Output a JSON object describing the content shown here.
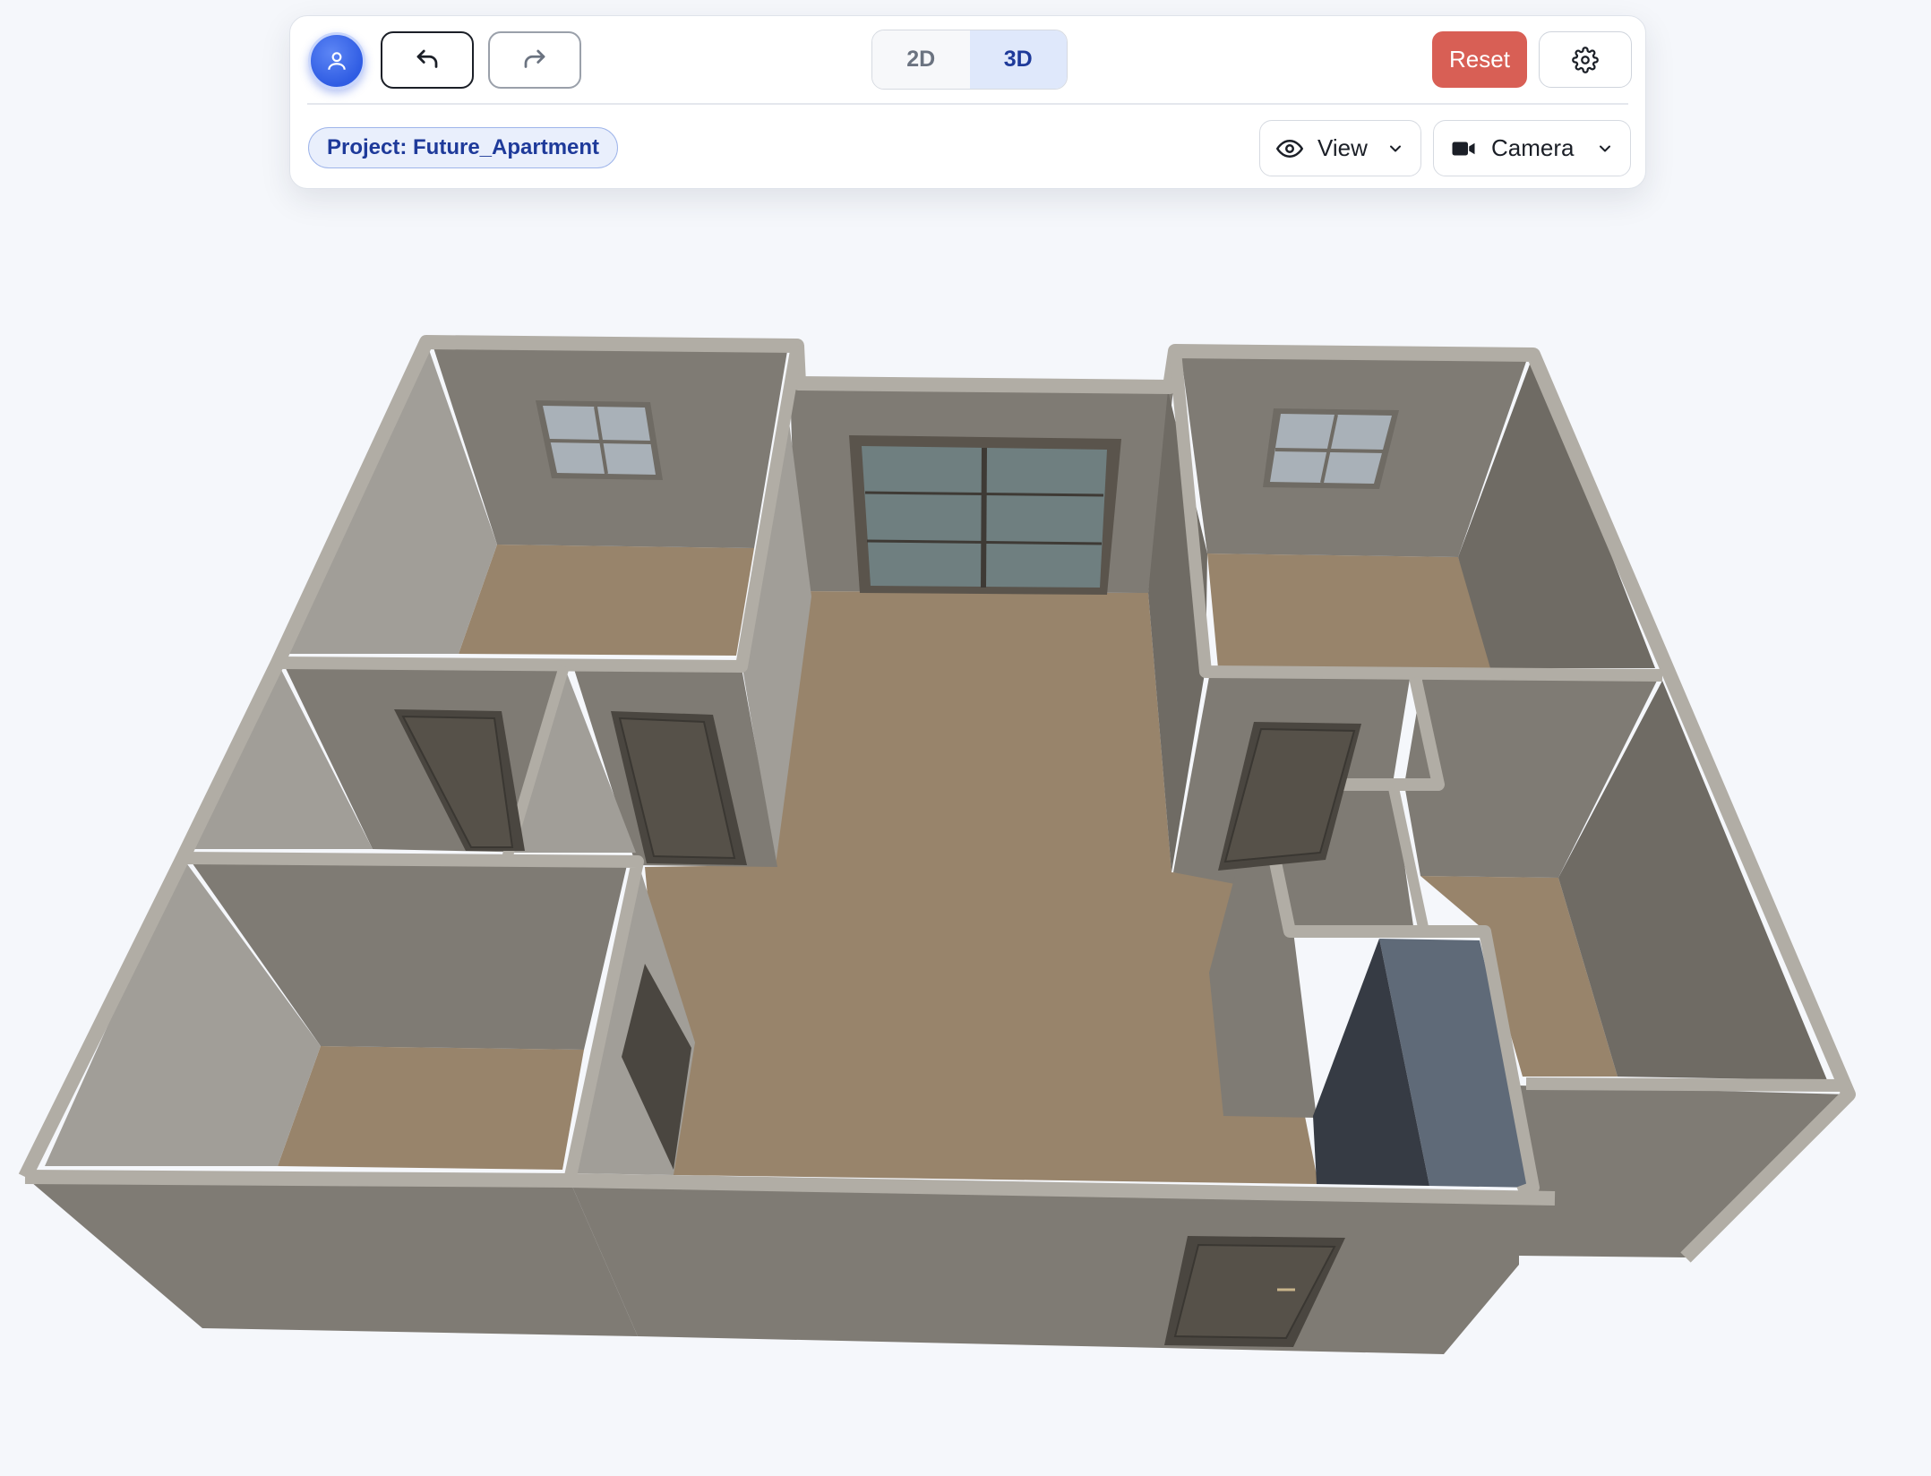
{
  "toolbar": {
    "avatar_icon": "user-icon",
    "undo_icon": "undo-arrow-icon",
    "redo_icon": "redo-arrow-icon",
    "mode_2d_label": "2D",
    "mode_3d_label": "3D",
    "active_mode": "3D",
    "reset_label": "Reset",
    "settings_icon": "gear-icon",
    "project_label": "Project: Future_Apartment",
    "view_label": "View",
    "camera_label": "Camera"
  },
  "colors": {
    "primary": "#2f5ce3",
    "active_tab_bg": "#dfe8fb",
    "active_tab_text": "#1e3a9a",
    "reset": "#d85f55",
    "floor": "#98846b",
    "wall_dark": "#7f7b74",
    "wall_light": "#a19e98",
    "wall_top": "#b1ada5",
    "door": "#4a4640",
    "window_glass": "#a9b1b8"
  }
}
